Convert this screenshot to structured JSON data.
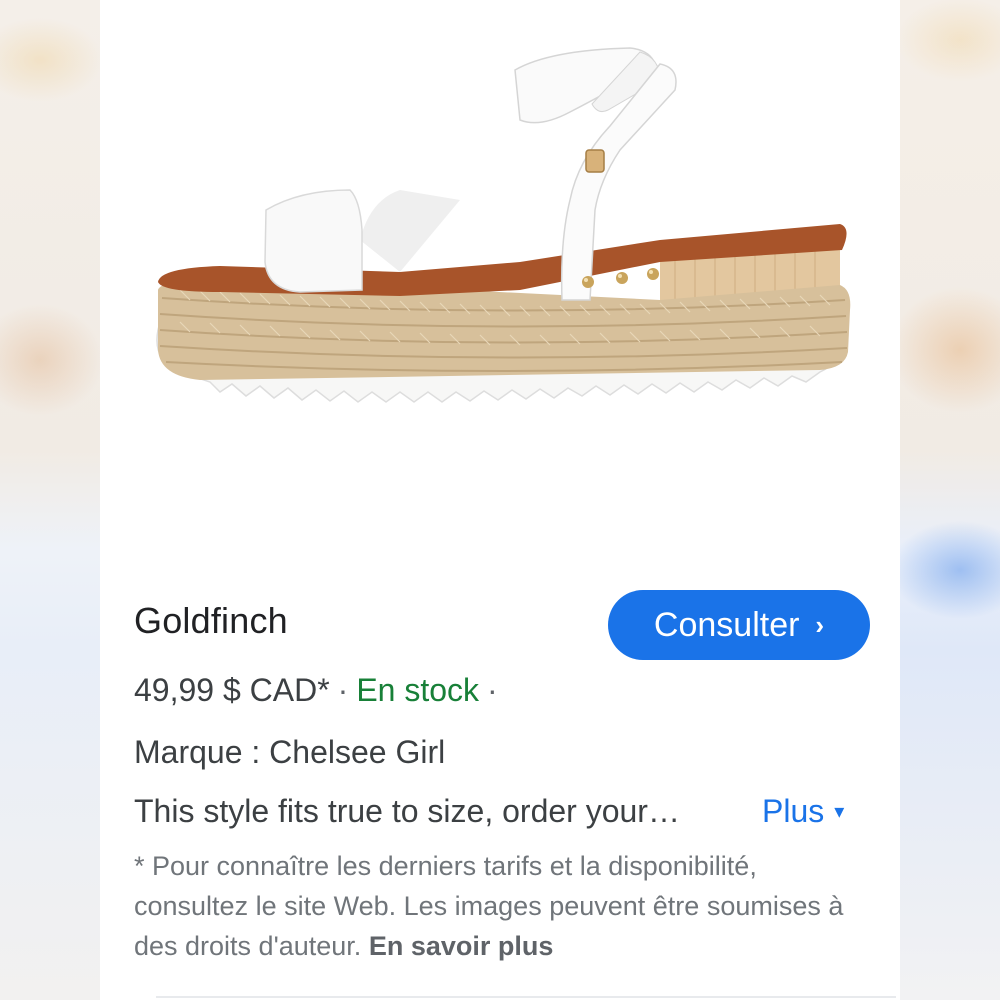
{
  "product": {
    "image_icon": "sandal-product-image",
    "title": "Goldfinch",
    "consult_label": "Consulter",
    "consult_chevron": "›",
    "price": "49,99 $ CAD*",
    "dot": "·",
    "stock": "En stock",
    "brand_line": "Marque : Chelsee Girl",
    "description": "This style fits true to size, order your…",
    "more_label": "Plus",
    "more_caret": "▾",
    "disclaimer_text": "* Pour connaître les derniers tarifs et la disponibilité, consultez le site Web. Les images peuvent être soumises à des droits d'auteur. ",
    "learn_more": "En savoir plus"
  },
  "colors": {
    "accent": "#1a73e8",
    "stock_green": "#188038",
    "text": "#3c4043",
    "muted": "#70757a"
  }
}
